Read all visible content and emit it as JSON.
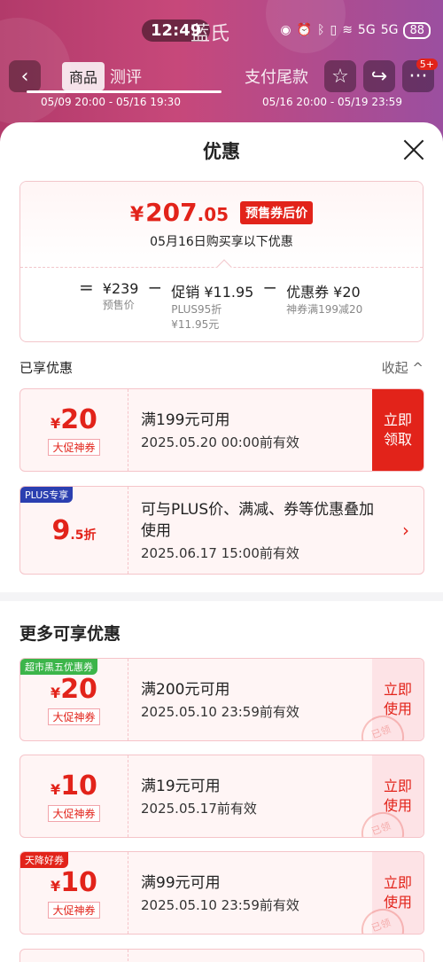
{
  "status": {
    "time": "12:49",
    "brand": "蓝氏",
    "battery": "88",
    "signal1": "5G",
    "signal2": "5G"
  },
  "bg": {
    "nav_tab_active": "商品",
    "nav_tab_2": "测评",
    "nav_right_label": "支付尾款",
    "timeline_left": "05/09 20:00 - 05/16 19:30",
    "timeline_right": "05/16 20:00 - 05/19 23:59",
    "badge": "5+"
  },
  "sheet": {
    "title": "优惠",
    "summary": {
      "price_yen": "¥",
      "price_int": "207",
      "price_dec": ".05",
      "price_tag": "预售券后价",
      "date_text": "05月16日购买享以下优惠",
      "f_eq": "=",
      "f1_main": "¥239",
      "f1_sub": "预售价",
      "f_minus1": "−",
      "f2_main": "促销 ¥11.95",
      "f2_sub1": "PLUS95折",
      "f2_sub2": "¥11.95元",
      "f_minus2": "−",
      "f3_main": "优惠券 ¥20",
      "f3_sub": "神券满199减20"
    },
    "enjoyed_title": "已享优惠",
    "collapse_label": "收起 ^",
    "enjoyed": [
      {
        "yen": "¥",
        "num": "20",
        "unit": "",
        "tag": "大促神券",
        "t1": "满199元可用",
        "t2": "2025.05.20 00:00前有效",
        "action": "立即领取",
        "corner": ""
      },
      {
        "yen": "",
        "num": "9",
        "unit": ".5折",
        "tag": "",
        "t1": "可与PLUS价、满减、券等优惠叠加使用",
        "t2": "2025.06.17 15:00前有效",
        "action": "›",
        "corner": "PLUS专享"
      }
    ],
    "more_title": "更多可享优惠",
    "more": [
      {
        "yen": "¥",
        "num": "20",
        "tag": "大促神券",
        "t1": "满200元可用",
        "t2": "2025.05.10 23:59前有效",
        "action": "立即使用",
        "corner": "超市黑五优惠券",
        "stamp": "已领"
      },
      {
        "yen": "¥",
        "num": "10",
        "tag": "大促神券",
        "t1": "满19元可用",
        "t2": "2025.05.17前有效",
        "action": "立即使用",
        "corner": "",
        "stamp": "已领"
      },
      {
        "yen": "¥",
        "num": "10",
        "tag": "大促神券",
        "t1": "满99元可用",
        "t2": "2025.05.10 23:59前有效",
        "action": "立即使用",
        "corner": "天降好券",
        "stamp": "已领"
      }
    ]
  },
  "colors": {
    "accent": "#e2231a",
    "plus": "#2b3fb0",
    "green_badge": "#3cb54a"
  }
}
